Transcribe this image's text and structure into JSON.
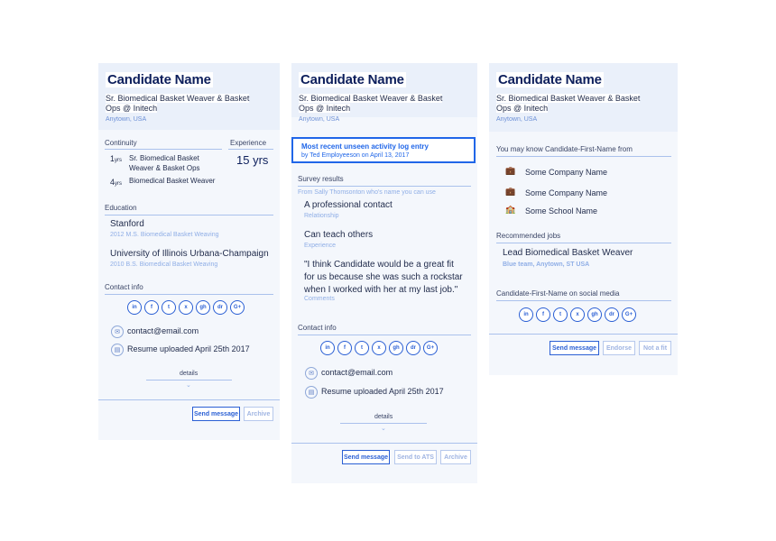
{
  "card1": {
    "name": "Candidate Name",
    "title_line1": "Sr. Biomedical Basket Weaver & Basket",
    "title_line2": "Ops @ Initech",
    "location": "Anytown, USA",
    "continuity_label": "Continuity",
    "experience_label": "Experience",
    "experience_value": "15 yrs",
    "continuity": [
      {
        "years": "1",
        "unit": "yrs",
        "line1": "Sr. Biomedical Basket",
        "line2": "Weaver & Basket Ops"
      },
      {
        "years": "4",
        "unit": "yrs",
        "line1": "Biomedical Basket Weaver",
        "line2": ""
      }
    ],
    "education_label": "Education",
    "education": [
      {
        "school": "Stanford",
        "detail": "2012 M.S. Biomedical Basket Weaving"
      },
      {
        "school": "University of Illinois Urbana-Champaign",
        "detail": "2010 B.S. Biomedical Basket Weaving"
      }
    ],
    "contact_label": "Contact info",
    "email": "contact@email.com",
    "resume": "Resume uploaded April 25th 2017",
    "details": "details",
    "buttons": {
      "send": "Send message",
      "archive": "Archive"
    }
  },
  "card2": {
    "name": "Candidate Name",
    "title_line1": "Sr. Biomedical Basket Weaver & Basket",
    "title_line2": "Ops @ Initech",
    "location": "Anytown, USA",
    "activity_title": "Most recent unseen activity log entry",
    "activity_sub": "by Ted Employeeson on April 13, 2017",
    "survey_label": "Survey results",
    "survey_from": "From Sally Thomsonton who's name you can use",
    "survey": [
      {
        "answer": "A professional contact",
        "category": "Relationship"
      },
      {
        "answer": "Can teach others",
        "category": "Experience"
      }
    ],
    "quote_line1": "\"I think Candidate would be a great fit",
    "quote_line2": "for us because she was such a rockstar",
    "quote_line3": "when I worked with her at my last job.\"",
    "quote_category": "Comments",
    "contact_label": "Contact info",
    "email": "contact@email.com",
    "resume": "Resume uploaded April 25th 2017",
    "details": "details",
    "buttons": {
      "send": "Send message",
      "ats": "Send to ATS",
      "archive": "Archive"
    }
  },
  "card3": {
    "name": "Candidate Name",
    "title_line1": "Sr. Biomedical Basket Weaver & Basket",
    "title_line2": "Ops @ Initech",
    "location": "Anytown, USA",
    "know_label": "You may know Candidate-First-Name from",
    "know": [
      {
        "name": "Some Company Name",
        "icon": "briefcase-icon"
      },
      {
        "name": "Some Company Name",
        "icon": "briefcase-icon"
      },
      {
        "name": "Some School Name",
        "icon": "school-icon"
      }
    ],
    "jobs_label": "Recommended jobs",
    "job_title": "Lead Biomedical Basket Weaver",
    "job_sub": "Blue team, Anytown, ST USA",
    "social_label": "Candidate-First-Name on social media",
    "buttons": {
      "send": "Send message",
      "endorse": "Endorse",
      "notfit": "Not a fit"
    }
  },
  "social_icons": [
    "in",
    "f",
    "t",
    "x",
    "gh",
    "dr",
    "G+"
  ],
  "colors": {
    "accent": "#2066e8",
    "dark_text": "#0d1f5c",
    "muted_blue": "#8faee6",
    "card_bg": "#f4f7fc"
  }
}
